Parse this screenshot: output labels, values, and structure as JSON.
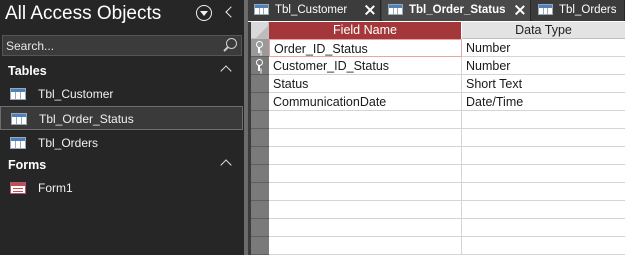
{
  "nav": {
    "title": "All Access Objects",
    "search": {
      "placeholder": "Search..."
    },
    "groups": [
      {
        "label": "Tables",
        "items": [
          {
            "label": "Tbl_Customer"
          },
          {
            "label": "Tbl_Order_Status",
            "selected": true
          },
          {
            "label": "Tbl_Orders"
          }
        ]
      },
      {
        "label": "Forms",
        "items": [
          {
            "label": "Form1"
          }
        ]
      }
    ]
  },
  "tabs": [
    {
      "label": "Tbl_Customer",
      "active": false
    },
    {
      "label": "Tbl_Order_Status",
      "active": true
    },
    {
      "label": "Tbl_Orders",
      "active": false
    }
  ],
  "design_grid": {
    "columns": {
      "field": "Field Name",
      "type": "Data Type"
    },
    "rows": [
      {
        "field": "Order_ID_Status",
        "type": "Number",
        "primary_key": true
      },
      {
        "field": "Customer_ID_Status",
        "type": "Number",
        "primary_key": true
      },
      {
        "field": "Status",
        "type": "Short Text",
        "primary_key": false
      },
      {
        "field": "CommunicationDate",
        "type": "Date/Time",
        "primary_key": false
      },
      {
        "field": "",
        "type": ""
      },
      {
        "field": "",
        "type": ""
      },
      {
        "field": "",
        "type": ""
      },
      {
        "field": "",
        "type": ""
      },
      {
        "field": "",
        "type": ""
      },
      {
        "field": "",
        "type": ""
      },
      {
        "field": "",
        "type": ""
      },
      {
        "field": "",
        "type": ""
      }
    ]
  },
  "colors": {
    "accent": "#a4373a",
    "nav_bg": "#262626",
    "tabbar_bg": "#3c3c3c"
  }
}
